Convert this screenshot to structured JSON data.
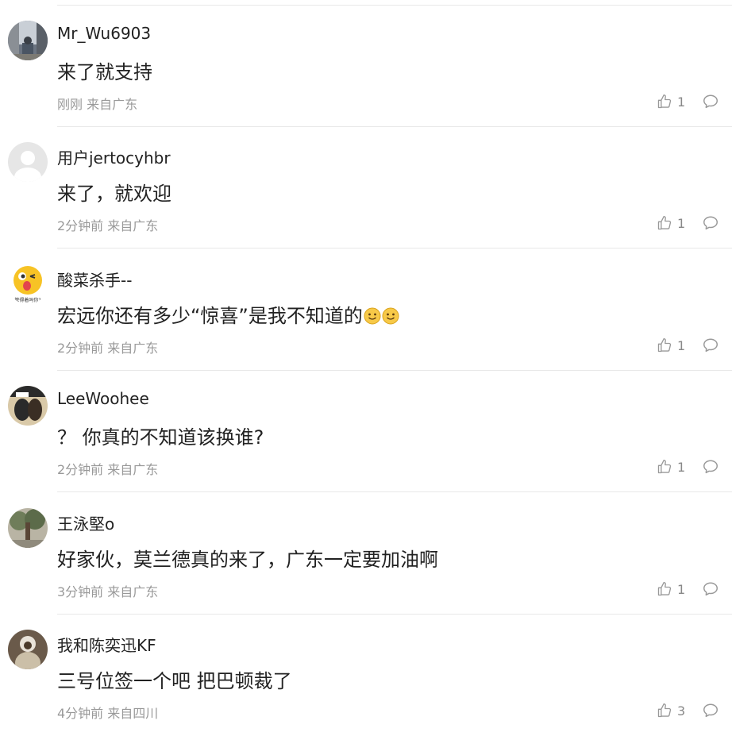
{
  "colors": {
    "text": "#222222",
    "meta": "#999999",
    "icon": "#999999",
    "divider": "#e8e8e8"
  },
  "comments": [
    {
      "avatar": "street-photo-avatar",
      "username": "Mr_Wu6903",
      "content": "来了就支持",
      "time": "刚刚",
      "location": "来自广东",
      "likes": "1"
    },
    {
      "avatar": "default-avatar",
      "username": "用户jertocyhbr",
      "content": "来了，就欢迎",
      "time": "2分钟前",
      "location": "来自广东",
      "likes": "1"
    },
    {
      "avatar": "tongue-emoji-avatar",
      "avatar_text": "管得着吗你?",
      "username": "酸菜杀手--",
      "content": "宏远你还有多少“惊喜”是我不知道的",
      "content_emojis": [
        "smile-emoji",
        "smile-emoji"
      ],
      "time": "2分钟前",
      "location": "来自广东",
      "likes": "1"
    },
    {
      "avatar": "portrait-avatar",
      "username": "LeeWoohee",
      "content": "？ 你真的不知道该换谁?",
      "time": "2分钟前",
      "location": "来自广东",
      "likes": "1"
    },
    {
      "avatar": "tree-avatar",
      "username": "王泳堅o",
      "content": "好家伙，莫兰德真的来了，广东一定要加油啊",
      "time": "3分钟前",
      "location": "来自广东",
      "likes": "1"
    },
    {
      "avatar": "figure-avatar",
      "username": "我和陈奕迅KF",
      "content": "三号位签一个吧 把巴顿裁了",
      "time": "4分钟前",
      "location": "来自四川",
      "likes": "3"
    }
  ]
}
